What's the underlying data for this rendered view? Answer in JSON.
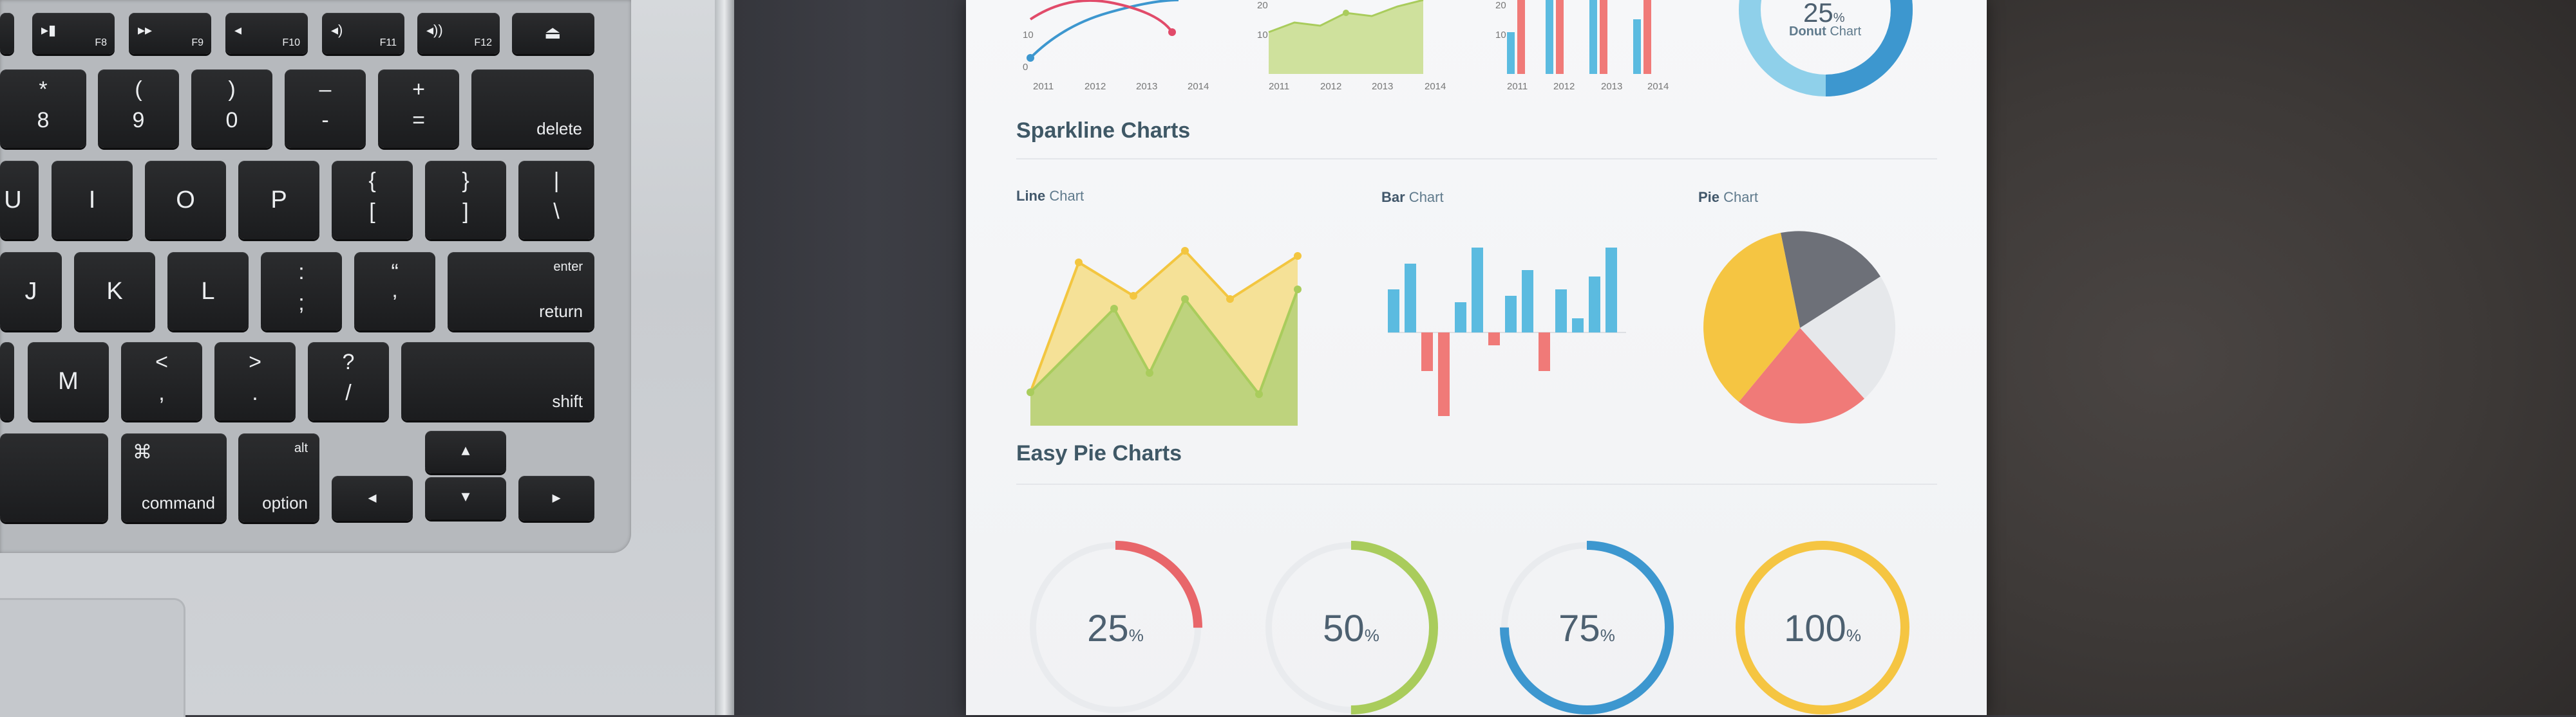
{
  "keyboard": {
    "fn_keys": [
      {
        "glyph": "▸▮",
        "label": "F8"
      },
      {
        "glyph": "▸▸",
        "label": "F9"
      },
      {
        "glyph": "◂",
        "label": "F10"
      },
      {
        "glyph": "◂)",
        "label": "F11"
      },
      {
        "glyph": "◂))",
        "label": "F12"
      },
      {
        "glyph": "⏏",
        "label": ""
      }
    ],
    "row_numbers": [
      {
        "top": "*",
        "bottom": "8"
      },
      {
        "top": "(",
        "bottom": "9"
      },
      {
        "top": ")",
        "bottom": "0"
      },
      {
        "top": "–",
        "bottom": "-"
      },
      {
        "top": "+",
        "bottom": "="
      }
    ],
    "delete": "delete",
    "row_letters_1": [
      "U",
      "I",
      "O",
      "P"
    ],
    "brackets": [
      {
        "top": "{",
        "bottom": "["
      },
      {
        "top": "}",
        "bottom": "]"
      },
      {
        "top": "|",
        "bottom": "\\"
      }
    ],
    "row_letters_2": [
      "J",
      "K",
      "L"
    ],
    "punct_2": [
      {
        "top": ":",
        "bottom": ";"
      },
      {
        "top": "“",
        "bottom": "’"
      }
    ],
    "enter_top": "enter",
    "enter_bottom": "return",
    "row_letters_3": [
      "M"
    ],
    "punct_3": [
      {
        "top": "<",
        "bottom": ","
      },
      {
        "top": ">",
        "bottom": "."
      },
      {
        "top": "?",
        "bottom": "/"
      }
    ],
    "shift": "shift",
    "command_glyph": "⌘",
    "command": "command",
    "alt": "alt",
    "option": "option",
    "arrow_left": "◂",
    "arrow_up": "▴",
    "arrow_down": "▾",
    "arrow_right": "▸"
  },
  "paper": {
    "top_charts": {
      "line_ticks_y": [
        "10",
        "0"
      ],
      "line_ticks_x": [
        "2011",
        "2012",
        "2013",
        "2014"
      ],
      "area_ticks_y": [
        "20",
        "10"
      ],
      "area_ticks_x": [
        "2011",
        "2012",
        "2013",
        "2014"
      ],
      "bar_ticks_y": [
        "20",
        "10"
      ],
      "bar_ticks_x": [
        "2011",
        "2012",
        "2013",
        "2014"
      ],
      "donut_value": "25",
      "donut_unit": "%",
      "donut_title_bold": "Donut",
      "donut_title_rest": " Chart"
    },
    "sparkline_title": "Sparkline Charts",
    "line_chart_bold": "Line",
    "line_chart_rest": " Chart",
    "bar_chart_bold": "Bar",
    "bar_chart_rest": " Chart",
    "pie_chart_bold": "Pie",
    "pie_chart_rest": " Chart",
    "easy_pie_title": "Easy Pie Charts",
    "easy_pies": [
      {
        "value": "25",
        "unit": "%",
        "fraction": 0.25,
        "color": "#e8666a"
      },
      {
        "value": "50",
        "unit": "%",
        "fraction": 0.5,
        "color": "#a9cc5c"
      },
      {
        "value": "75",
        "unit": "%",
        "fraction": 0.75,
        "color": "#3d97cf"
      },
      {
        "value": "100",
        "unit": "%",
        "fraction": 1.0,
        "color": "#f5c542"
      }
    ]
  },
  "colors": {
    "yellow": "#f5c542",
    "green": "#a9cc5c",
    "blue": "#5bbbe0",
    "red": "#f07a78",
    "grey": "#6d7078",
    "light": "#e6e8eb"
  }
}
